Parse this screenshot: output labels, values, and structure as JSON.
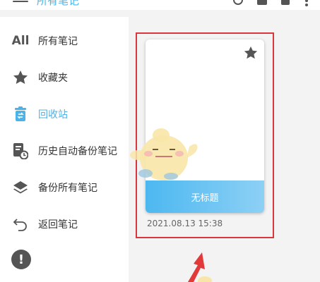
{
  "header": {
    "title": "所有笔记",
    "icons": [
      "menu-icon",
      "search-icon",
      "bell-icon",
      "document-icon",
      "more-icon"
    ]
  },
  "sidebar": {
    "items": [
      {
        "icon": "all-icon",
        "icon_text": "All",
        "label": "所有笔记",
        "active": false
      },
      {
        "icon": "star-icon",
        "label": "收藏夹",
        "active": false
      },
      {
        "icon": "recycle-bin-icon",
        "label": "回收站",
        "active": true
      },
      {
        "icon": "history-backup-icon",
        "label": "历史自动备份笔记",
        "active": false
      },
      {
        "icon": "layers-icon",
        "label": "备份所有笔记",
        "active": false
      },
      {
        "icon": "return-icon",
        "label": "返回笔记",
        "active": false
      }
    ],
    "bottom_icon": "exclamation-icon"
  },
  "note": {
    "title": "无标题",
    "date": "2021.08.13 15:38",
    "starred": true
  },
  "colors": {
    "accent": "#4cb3e8",
    "highlight_border": "#d9363e",
    "icon_gray": "#555555"
  }
}
